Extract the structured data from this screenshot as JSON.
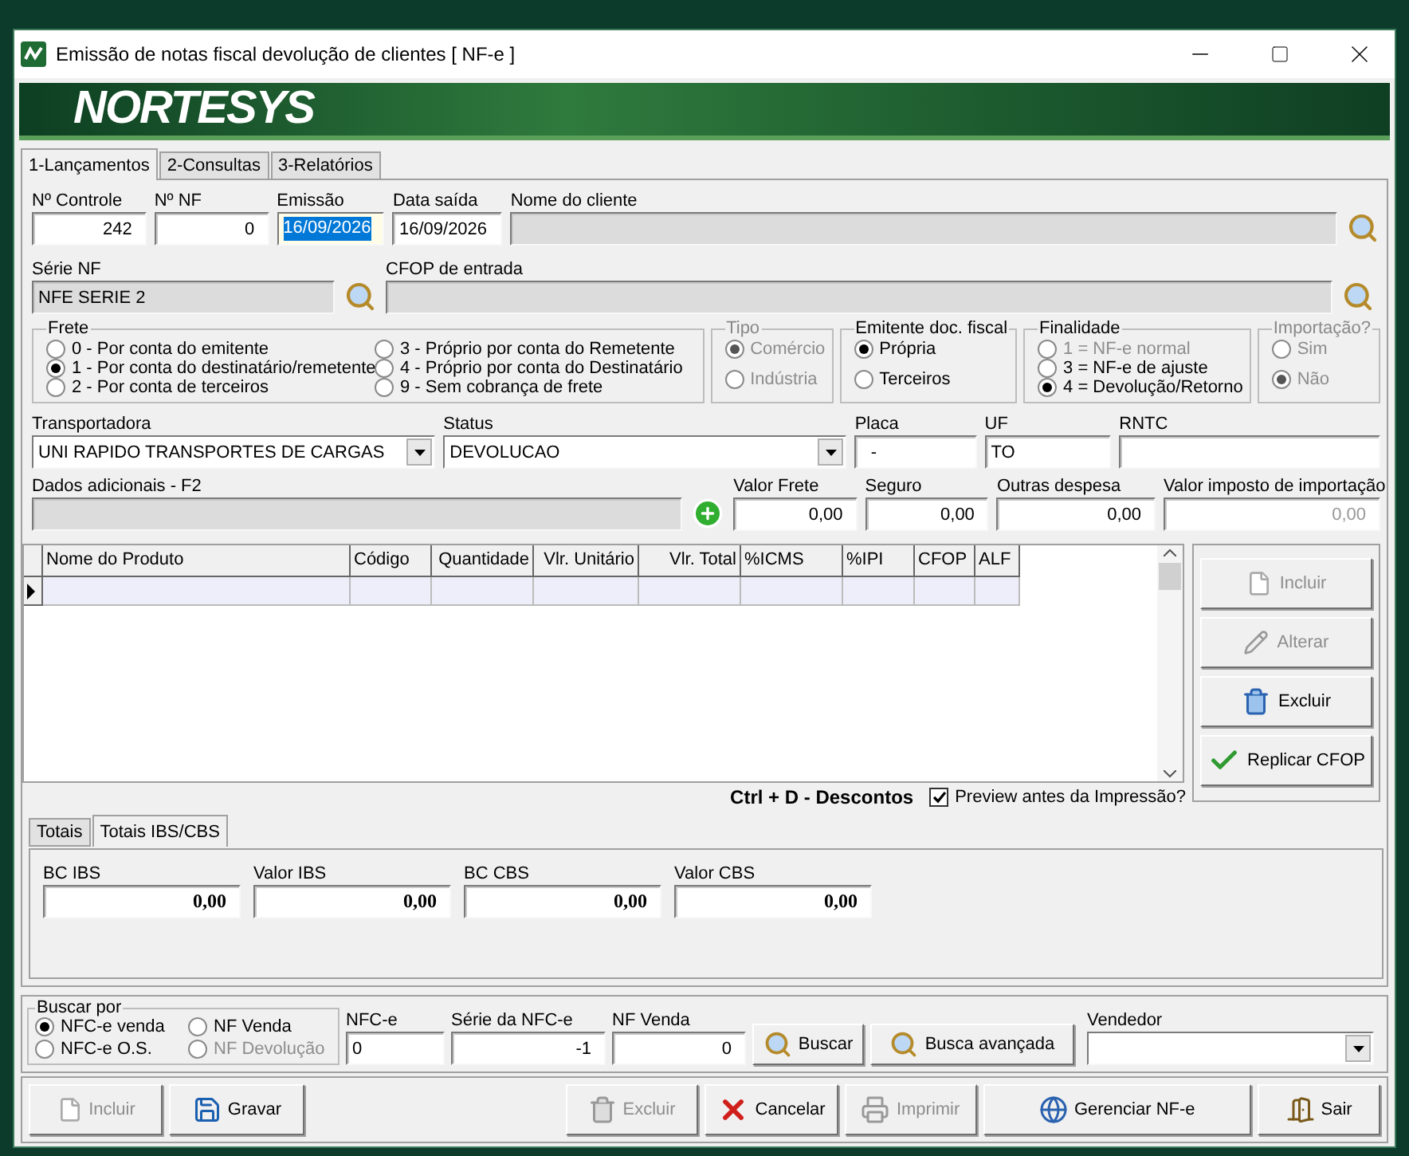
{
  "window": {
    "title": "Emissão de notas fiscal devolução de clientes [ NF-e ]"
  },
  "banner": {
    "logo": "NORTESYS"
  },
  "tabs": [
    {
      "label": "1-Lançamentos",
      "selected": true
    },
    {
      "label": "2-Consultas",
      "selected": false
    },
    {
      "label": "3-Relatórios",
      "selected": false
    }
  ],
  "header_row": [
    {
      "label": "Nº  Controle",
      "value": "242",
      "kind": "number",
      "disabled": false,
      "focused": false
    },
    {
      "label": "Nº  NF",
      "value": "0",
      "kind": "number",
      "disabled": false,
      "focused": false
    },
    {
      "label": "Emissão",
      "value": "16/09/2026",
      "kind": "text",
      "disabled": false,
      "focused": true
    },
    {
      "label": "Data saída",
      "value": "16/09/2026",
      "kind": "text",
      "disabled": false,
      "focused": false
    },
    {
      "label": "Nome do cliente",
      "kind": "text",
      "disabled": true,
      "focused": false,
      "lookup": true
    }
  ],
  "serie_row": [
    {
      "label": "Série NF",
      "value": "NFE SERIE 2",
      "kind": "text",
      "disabled": true,
      "lookup": true
    },
    {
      "label": "CFOP de entrada",
      "kind": "text",
      "disabled": true,
      "lookup": true
    }
  ],
  "option_groups": [
    {
      "title": "Frete",
      "kind": "columns",
      "disabled": false,
      "options": [
        {
          "label": "0 - Por conta do emitente",
          "selected": false,
          "disabled": false
        },
        {
          "label": "1 - Por conta do destinatário/remetente",
          "selected": true,
          "disabled": false
        },
        {
          "label": "2 - Por conta de terceiros",
          "selected": false,
          "disabled": false
        },
        {
          "label": "3 - Próprio por conta do Remetente",
          "selected": false,
          "disabled": false
        },
        {
          "label": "4 - Próprio por conta do Destinatário",
          "selected": false,
          "disabled": false
        },
        {
          "label": "9 - Sem cobrança de frete",
          "selected": false,
          "disabled": false
        }
      ]
    },
    {
      "title": "Tipo",
      "kind": "list",
      "disabled": true,
      "options": [
        {
          "label": "Comércio",
          "selected": true,
          "disabled": true
        },
        {
          "label": "Indústria",
          "selected": false,
          "disabled": true
        }
      ]
    },
    {
      "title": "Emitente doc. fiscal",
      "kind": "list",
      "disabled": false,
      "options": [
        {
          "label": "Própria",
          "selected": true,
          "disabled": false
        },
        {
          "label": "Terceiros",
          "selected": false,
          "disabled": false
        }
      ]
    },
    {
      "title": "Finalidade",
      "kind": "compact",
      "disabled": false,
      "options": [
        {
          "label": "1 = NF-e normal",
          "selected": false,
          "disabled": true
        },
        {
          "label": "3 = NF-e de ajuste",
          "selected": false,
          "disabled": false
        },
        {
          "label": "4 = Devolução/Retorno",
          "selected": true,
          "disabled": false
        }
      ]
    },
    {
      "title": "Importação?",
      "kind": "list",
      "disabled": true,
      "options": [
        {
          "label": "Sim",
          "selected": false,
          "disabled": true
        },
        {
          "label": "Não",
          "selected": true,
          "disabled": true
        }
      ]
    }
  ],
  "transport_row": [
    {
      "label": "Transportadora",
      "value": "UNI RAPIDO TRANSPORTES DE CARGAS",
      "kind": "combo"
    },
    {
      "label": "Status",
      "value": "DEVOLUCAO",
      "kind": "combo"
    },
    {
      "label": "Placa",
      "value": "  -",
      "kind": "text"
    },
    {
      "label": "UF",
      "value": "TO",
      "kind": "text"
    },
    {
      "label": "RNTC",
      "kind": "text"
    }
  ],
  "values_row": [
    {
      "label": "Dados adicionais - F2",
      "kind": "text",
      "disabled": true,
      "add": true
    },
    {
      "label": "Valor Frete",
      "value": "0,00",
      "kind": "number",
      "disabled": false
    },
    {
      "label": "Seguro",
      "value": "0,00",
      "kind": "number",
      "disabled": false
    },
    {
      "label": "Outras despesa",
      "value": "0,00",
      "kind": "number",
      "disabled": false
    },
    {
      "label": "Valor imposto de importação",
      "value": "0,00",
      "kind": "number",
      "disabled": true
    }
  ],
  "grid": {
    "columns": [
      "Nome do Produto",
      "Código",
      "Quantidade",
      "Vlr. Unitário",
      "Vlr. Total",
      "%ICMS",
      "%IPI",
      "CFOP",
      "ALF"
    ],
    "rows": [
      {
        "selected": true
      }
    ]
  },
  "side_buttons": [
    {
      "label": "Incluir",
      "kind": "add",
      "disabled": true
    },
    {
      "label": "Alterar",
      "kind": "edit",
      "disabled": true
    },
    {
      "label": "Excluir",
      "kind": "delete",
      "disabled": false
    },
    {
      "label": "Replicar CFOP",
      "kind": "check",
      "disabled": false
    }
  ],
  "shortcut_hint": "Ctrl + D - Descontos",
  "preview": {
    "label": "Preview antes da Impressão?",
    "checked": true
  },
  "total_tabs": [
    {
      "label": "Totais",
      "selected": false
    },
    {
      "label": "Totais IBS/CBS",
      "selected": true
    }
  ],
  "totals": [
    {
      "label": "BC IBS",
      "value": "0,00"
    },
    {
      "label": "Valor IBS",
      "value": "0,00"
    },
    {
      "label": "BC CBS",
      "value": "0,00"
    },
    {
      "label": "Valor CBS",
      "value": "0,00"
    }
  ],
  "search": {
    "group": {
      "title": "Buscar por",
      "options": [
        {
          "label": "NFC-e venda",
          "selected": true,
          "disabled": false
        },
        {
          "label": "NF Venda",
          "selected": false,
          "disabled": false
        },
        {
          "label": "NFC-e O.S.",
          "selected": false,
          "disabled": false
        },
        {
          "label": "NF Devolução",
          "selected": false,
          "disabled": true
        }
      ]
    },
    "fields": [
      {
        "label": "NFC-e",
        "value": "0",
        "kind": "text"
      },
      {
        "label": "Série da NFC-e",
        "value": "-1",
        "kind": "number"
      },
      {
        "label": "NF Venda",
        "value": "0",
        "kind": "number"
      }
    ],
    "buttons": [
      {
        "label": "Buscar",
        "kind": "search"
      },
      {
        "label": "Busca avançada",
        "kind": "search"
      }
    ],
    "seller": {
      "label": "Vendedor",
      "kind": "combo"
    }
  },
  "toolbar": [
    {
      "label": "Incluir",
      "kind": "add",
      "disabled": true
    },
    {
      "label": "Gravar",
      "kind": "save",
      "disabled": false
    },
    {
      "label": "Excluir",
      "kind": "delete",
      "disabled": true
    },
    {
      "label": "Cancelar",
      "kind": "cancel",
      "disabled": false
    },
    {
      "label": "Imprimir",
      "kind": "print",
      "disabled": true
    },
    {
      "label": "Gerenciar NF-e",
      "kind": "globe",
      "disabled": false
    },
    {
      "label": "Sair",
      "kind": "exit",
      "disabled": false
    }
  ]
}
